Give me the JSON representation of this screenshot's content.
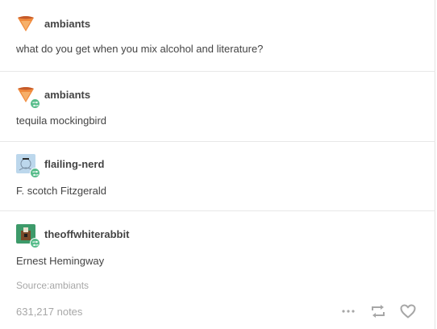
{
  "colors": {
    "text": "#444444",
    "muted": "#a7a7a7",
    "divider": "#e8e8e8",
    "reblog_badge": "#56bc8a"
  },
  "entries": [
    {
      "username": "ambiants",
      "avatar_icon": "cone-avatar",
      "reblogged": false,
      "text": "what do you get when you mix alcohol and literature?"
    },
    {
      "username": "ambiants",
      "avatar_icon": "cone-avatar",
      "reblogged": true,
      "text": "tequila mockingbird"
    },
    {
      "username": "flailing-nerd",
      "avatar_icon": "sketch-avatar",
      "reblogged": true,
      "text": "F. scotch Fitzgerald"
    },
    {
      "username": "theoffwhiterabbit",
      "avatar_icon": "rabbit-avatar",
      "reblogged": true,
      "text": "Ernest Hemingway"
    }
  ],
  "footer": {
    "source_label": "Source:",
    "source_name": "ambiants",
    "notes": "631,217 notes",
    "icons": [
      "more-icon",
      "reblog-icon",
      "heart-icon"
    ]
  }
}
